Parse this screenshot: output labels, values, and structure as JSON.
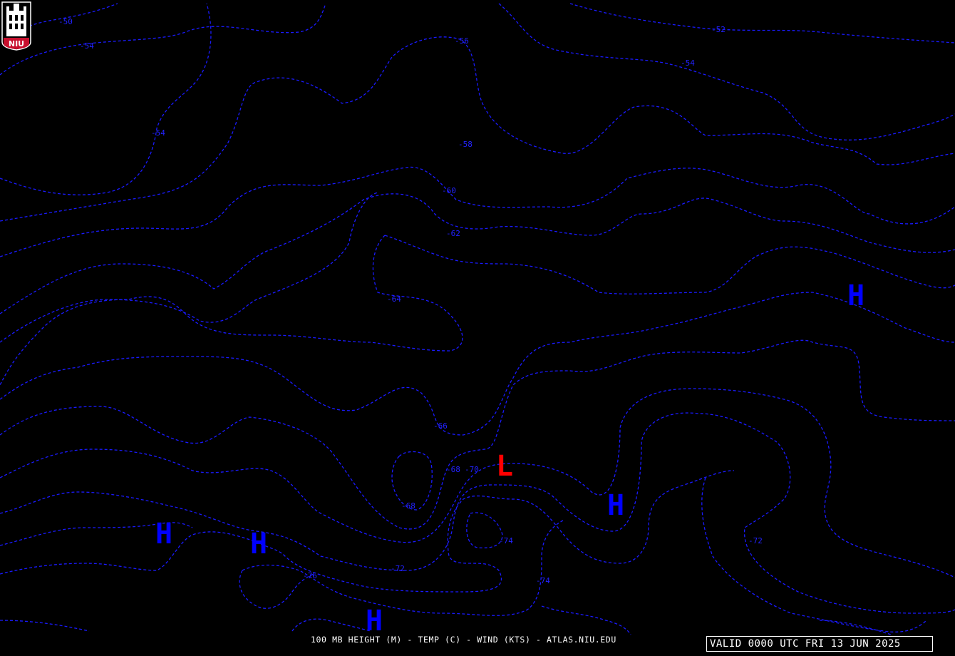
{
  "logo": {
    "text": "NIU",
    "colors": {
      "shield": "#c8102e",
      "tower": "#ffffff",
      "outline": "#ffffff"
    }
  },
  "map": {
    "contour_color": "#1a1aff",
    "high_color": "#0000ff",
    "low_color": "#ff0000",
    "contour_labels": [
      "-50",
      "-52",
      "-54",
      "-54",
      "-54",
      "-56",
      "-58",
      "-60",
      "-62",
      "-64",
      "-66",
      "-68",
      "-68",
      "-70",
      "-72",
      "-72",
      "-74",
      "-74",
      "-76"
    ],
    "pressure_centers": [
      {
        "type": "high",
        "symbol": "H"
      },
      {
        "type": "high",
        "symbol": "H"
      },
      {
        "type": "high",
        "symbol": "H"
      },
      {
        "type": "high",
        "symbol": "H"
      },
      {
        "type": "high",
        "symbol": "H"
      },
      {
        "type": "low",
        "symbol": "L"
      }
    ]
  },
  "footer": {
    "caption": "100 MB HEIGHT (M) - TEMP (C) - WIND (KTS) - ATLAS.NIU.EDU",
    "valid_time": "VALID 0000 UTC FRI 13 JUN 2025"
  }
}
